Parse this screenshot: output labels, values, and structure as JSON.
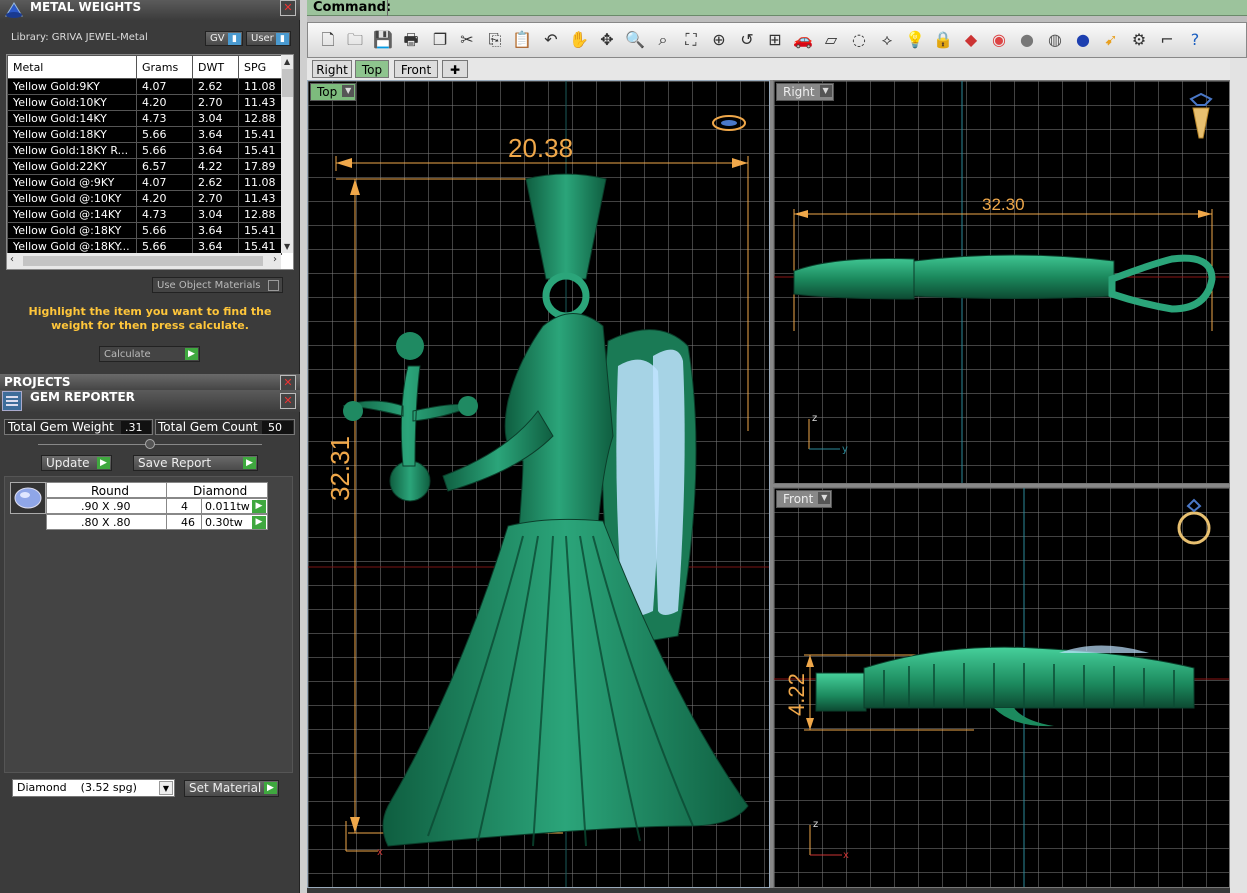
{
  "metal_weights": {
    "title": "METAL WEIGHTS",
    "library": "Library: GRIVA JEWEL-Metal",
    "gv_label": "GV",
    "user_label": "User",
    "columns": [
      "Metal",
      "Grams",
      "DWT",
      "SPG"
    ],
    "rows": [
      [
        "Yellow Gold:9KY",
        "4.07",
        "2.62",
        "11.08"
      ],
      [
        "Yellow Gold:10KY",
        "4.20",
        "2.70",
        "11.43"
      ],
      [
        "Yellow Gold:14KY",
        "4.73",
        "3.04",
        "12.88"
      ],
      [
        "Yellow Gold:18KY",
        "5.66",
        "3.64",
        "15.41"
      ],
      [
        "Yellow Gold:18KY R...",
        "5.66",
        "3.64",
        "15.41"
      ],
      [
        "Yellow Gold:22KY",
        "6.57",
        "4.22",
        "17.89"
      ],
      [
        "Yellow Gold @:9KY",
        "4.07",
        "2.62",
        "11.08"
      ],
      [
        "Yellow Gold @:10KY",
        "4.20",
        "2.70",
        "11.43"
      ],
      [
        "Yellow Gold @:14KY",
        "4.73",
        "3.04",
        "12.88"
      ],
      [
        "Yellow Gold @:18KY",
        "5.66",
        "3.64",
        "15.41"
      ],
      [
        "Yellow Gold @:18KY...",
        "5.66",
        "3.64",
        "15.41"
      ]
    ],
    "use_object_materials": "Use Object Materials",
    "instruction": "Highlight the item you want to find the weight for then press calculate.",
    "calculate_label": "Calculate"
  },
  "projects": {
    "title": "PROJECTS"
  },
  "gem_reporter": {
    "title": "GEM REPORTER",
    "total_weight_label": "Total Gem Weight",
    "total_weight_value": ".31",
    "total_count_label": "Total Gem Count",
    "total_count_value": "50",
    "update_label": "Update",
    "save_report_label": "Save Report",
    "columns": [
      "Round",
      "Diamond"
    ],
    "rows": [
      {
        "size": ".90 X .90",
        "count": "4",
        "weight": "0.011tw"
      },
      {
        "size": ".80 X .80",
        "count": "46",
        "weight": "0.30tw"
      }
    ],
    "material_select": "Diamond    (3.52 spg)",
    "set_material_label": "Set Material"
  },
  "command": {
    "label": "Command:"
  },
  "tabs": [
    "Right",
    "Top",
    "Front"
  ],
  "viewports": {
    "top": {
      "label": "Top",
      "width_dim": "20.38",
      "height_dim": "32.31"
    },
    "right": {
      "label": "Right",
      "length_dim": "32.30"
    },
    "front": {
      "label": "Front",
      "height_dim": "4.22"
    }
  },
  "colors": {
    "model": "#1f8a62",
    "dimension": "#f0a84a",
    "grid_bg": "#000000",
    "viewport_active": "#7dbb7d"
  }
}
